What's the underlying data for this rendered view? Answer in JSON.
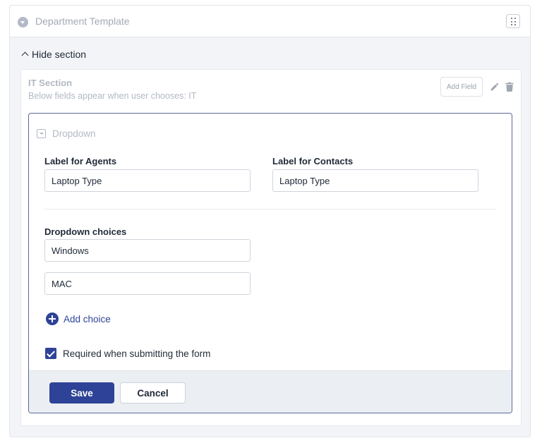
{
  "template": {
    "title": "Department Template",
    "icon": "chevron-circle-icon",
    "grip_icon": "grid-dots-icon"
  },
  "toggle": {
    "label": "Hide section"
  },
  "section": {
    "title": "IT Section",
    "subtitle": "Below fields appear when user chooses: IT",
    "add_field_label": "Add Field"
  },
  "field": {
    "type_label": "Dropdown",
    "agents_label": "Label for Agents",
    "agents_value": "Laptop Type",
    "contacts_label": "Label for Contacts",
    "contacts_value": "Laptop Type",
    "choices_label": "Dropdown choices",
    "choices": [
      "Windows",
      "MAC"
    ],
    "add_choice_label": "Add choice",
    "required_label": "Required when submitting the form",
    "required_checked": true
  },
  "footer": {
    "save_label": "Save",
    "cancel_label": "Cancel"
  },
  "colors": {
    "primary": "#2e4397",
    "card_border": "#5a6a95",
    "muted_text": "#b2b8c3"
  }
}
